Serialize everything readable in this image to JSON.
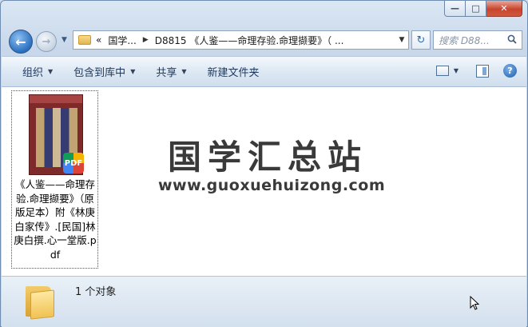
{
  "window": {
    "caption": {
      "minimize": "—",
      "maximize": "□",
      "close": "✕"
    }
  },
  "nav": {
    "back_glyph": "←",
    "forward_glyph": "→",
    "history_dropdown": "▼"
  },
  "address": {
    "overflow": "«",
    "crumb1": "国学...",
    "sep": "▶",
    "crumb2": "D8815 《人鉴——命理存验.命理撷要》（ ...",
    "dropdown": "▼"
  },
  "refresh_glyph": "↻",
  "search": {
    "placeholder": "搜索 D88...",
    "icon": "search-icon"
  },
  "toolbar": {
    "organize": "组织",
    "include_library": "包含到库中",
    "share": "共享",
    "new_folder": "新建文件夹",
    "caret": "▼",
    "help": "?"
  },
  "files": [
    {
      "name": "《人鉴——命理存验.命理撷要》（原版足本）附《林庚白家传》.[民国]林庚白撰.心一堂版.pdf",
      "badge": "PDF"
    }
  ],
  "watermark": {
    "title": "国学汇总站",
    "url": "www.guoxuehuizong.com"
  },
  "status": {
    "count_text": "1 个对象"
  }
}
